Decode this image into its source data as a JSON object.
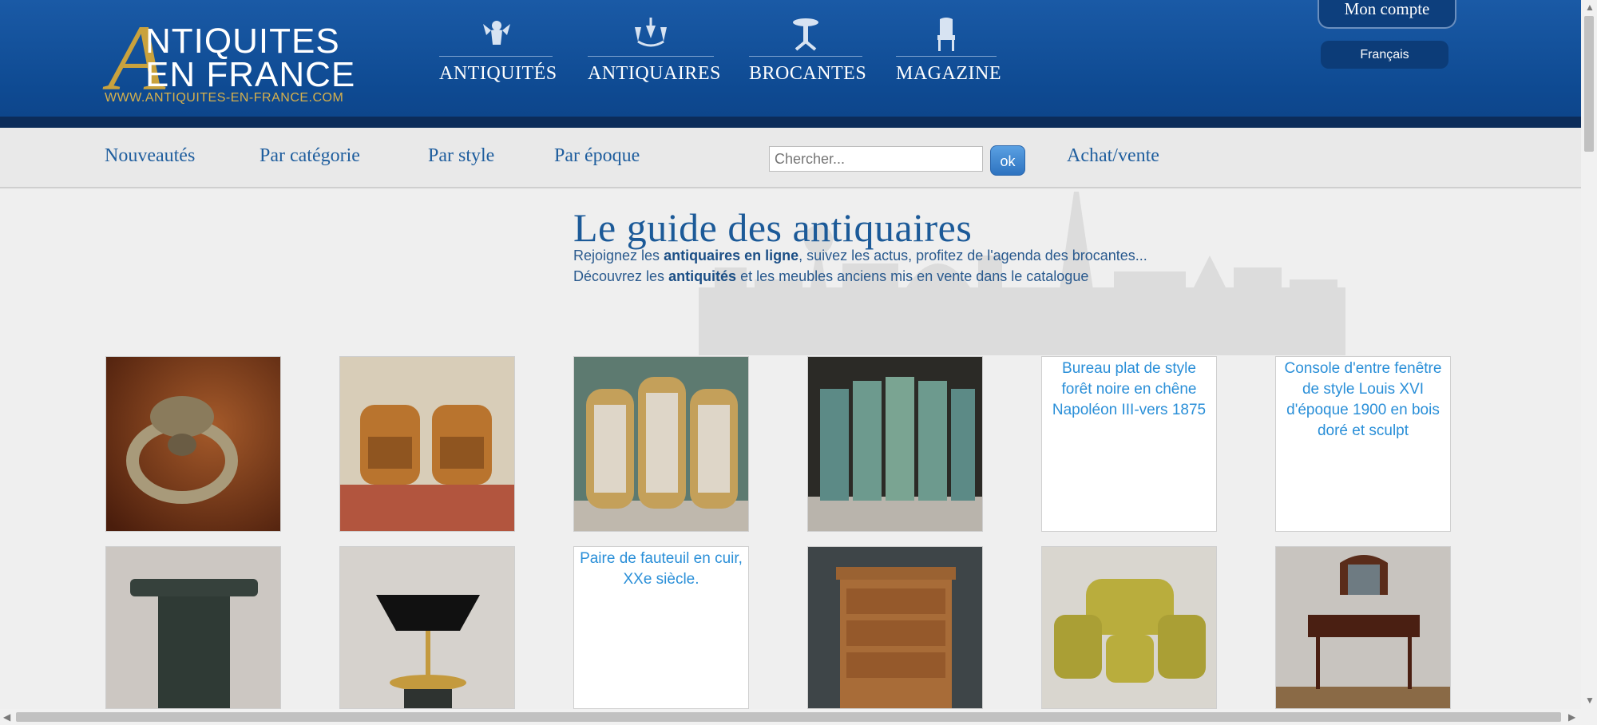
{
  "brand": {
    "line1": "NTIQUITES",
    "line2": "EN FRANCE",
    "initial": "A",
    "url": "WWW.ANTIQUITES-EN-FRANCE.COM",
    "gold": "#c9a23d"
  },
  "top_nav": [
    {
      "label": "ANTIQUITÉS",
      "icon": "cherub-icon"
    },
    {
      "label": "ANTIQUAIRES",
      "icon": "chandelier-icon"
    },
    {
      "label": "BROCANTES",
      "icon": "pedestal-table-icon"
    },
    {
      "label": "MAGAZINE",
      "icon": "chair-icon"
    }
  ],
  "account": {
    "label": "Mon compte"
  },
  "language": {
    "label": "Français"
  },
  "sub_nav": {
    "links": [
      "Nouveautés",
      "Par catégorie",
      "Par style",
      "Par époque"
    ],
    "search_placeholder": "Chercher...",
    "search_button": "ok",
    "buy_sell": "Achat/vente"
  },
  "hero": {
    "title": "Le guide des antiquaires",
    "line1_pre": "Rejoignez les ",
    "line1_bold": "antiquaires en ligne",
    "line1_post": ", suivez les actus, profitez de l'agenda des brocantes...",
    "line2_pre": "Découvrez les ",
    "line2_bold": "antiquités",
    "line2_post": " et les meubles anciens mis en vente dans le catalogue"
  },
  "products_row1": [
    {
      "type": "image",
      "icon": "bronze-handle-icon"
    },
    {
      "type": "image",
      "icon": "leather-armchairs-icon"
    },
    {
      "type": "image",
      "icon": "gilded-screen-icon"
    },
    {
      "type": "image",
      "icon": "painted-screen-icon"
    },
    {
      "type": "alt",
      "alt": "Bureau plat de style forêt noire en chêne Napoléon III-vers 1875"
    },
    {
      "type": "alt",
      "alt": "Console d'entre fenêtre de style Louis XVI d'époque 1900 en bois doré et sculpt"
    }
  ],
  "products_row2": [
    {
      "type": "image",
      "icon": "marble-pedestal-icon"
    },
    {
      "type": "image",
      "icon": "bouillotte-lamp-icon"
    },
    {
      "type": "alt",
      "alt": "Paire de fauteuil en cuir, XXe siècle."
    },
    {
      "type": "image",
      "icon": "chest-of-drawers-icon"
    },
    {
      "type": "image",
      "icon": "salon-set-icon"
    },
    {
      "type": "image",
      "icon": "dressing-table-icon"
    }
  ],
  "colors": {
    "header": "#0e4a92",
    "link": "#1f5e9e",
    "alt_text": "#2a8fd8"
  }
}
